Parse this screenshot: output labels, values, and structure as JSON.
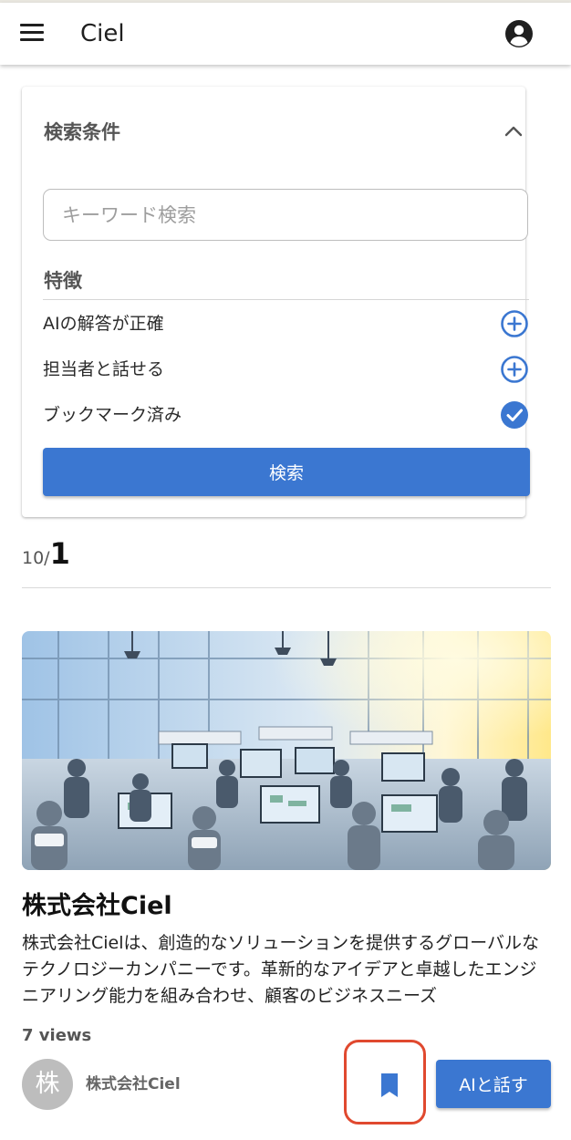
{
  "app": {
    "title": "Ciel"
  },
  "search_panel": {
    "title": "検索条件",
    "keyword_placeholder": "キーワード検索",
    "features_heading": "特徴",
    "features": [
      {
        "label": "AIの解答が正確",
        "state": "add",
        "icon": "plus-circle-icon"
      },
      {
        "label": "担当者と話せる",
        "state": "add",
        "icon": "plus-circle-icon"
      },
      {
        "label": "ブックマーク済み",
        "state": "selected",
        "icon": "check-circle-icon"
      }
    ],
    "search_button": "検索"
  },
  "results": {
    "total": "10/",
    "page": "1"
  },
  "company_card": {
    "image_alt": "Illustration of a busy open-plan tech office",
    "name": "株式会社Ciel",
    "description": "株式会社Cielは、創造的なソリューションを提供するグローバルなテクノロジーカンパニーです。革新的なアイデアと卓越したエンジニアリング能力を組み合わせ、顧客のビジネスニーズ",
    "views": "7 views",
    "avatar_char": "株",
    "owner_name": "株式会社Ciel",
    "ai_button": "AIと話す",
    "bookmark_icon": "bookmark-icon"
  },
  "colors": {
    "primary": "#3b77d1",
    "highlight": "#e0492f",
    "avatar_bg": "#bdbdbd",
    "text_muted": "#555555"
  }
}
